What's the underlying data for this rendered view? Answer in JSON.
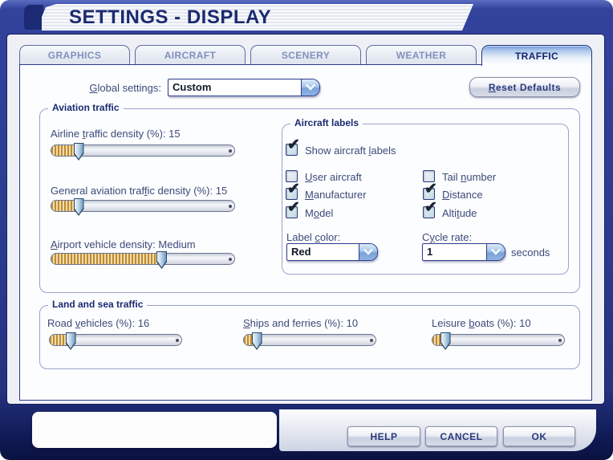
{
  "window": {
    "title": "SETTINGS - DISPLAY"
  },
  "tabs": [
    {
      "label": "GRAPHICS",
      "active": false
    },
    {
      "label": "AIRCRAFT",
      "active": false
    },
    {
      "label": "SCENERY",
      "active": false
    },
    {
      "label": "WEATHER",
      "active": false
    },
    {
      "label": "TRAFFIC",
      "active": true
    }
  ],
  "global_settings": {
    "label": {
      "text": "Global settings:",
      "accel": 0
    },
    "value": "Custom"
  },
  "reset_button": {
    "text": "Reset Defaults",
    "accel": 0
  },
  "aviation_traffic": {
    "title": "Aviation traffic",
    "sliders": [
      {
        "label": {
          "text": "Airline traffic density (%): 15",
          "accel": 8
        },
        "percent": 15
      },
      {
        "label": {
          "text": "General aviation traffic density (%): 15",
          "accel": 21
        },
        "percent": 15
      },
      {
        "label": {
          "text": "Airport vehicle density: Medium",
          "accel": 0
        },
        "percent": 60
      }
    ]
  },
  "aircraft_labels": {
    "title": "Aircraft labels",
    "show": {
      "label": {
        "text": "Show aircraft labels",
        "accel": 14
      },
      "checked": true
    },
    "options": [
      {
        "label": {
          "text": "User aircraft",
          "accel": 0
        },
        "checked": false
      },
      {
        "label": {
          "text": "Tail number",
          "accel": 5
        },
        "checked": false
      },
      {
        "label": {
          "text": "Manufacturer",
          "accel": 0
        },
        "checked": true
      },
      {
        "label": {
          "text": "Distance",
          "accel": 0
        },
        "checked": true
      },
      {
        "label": {
          "text": "Model",
          "accel": 1
        },
        "checked": true
      },
      {
        "label": {
          "text": "Altitude",
          "accel": 4
        },
        "checked": true
      }
    ],
    "label_color": {
      "label": {
        "text": "Label color:",
        "accel": 6
      },
      "value": "Red"
    },
    "cycle_rate": {
      "label": {
        "text": "Cycle rate:",
        "accel": 1
      },
      "value": "1",
      "unit": "seconds"
    }
  },
  "land_sea_traffic": {
    "title": "Land and sea traffic",
    "sliders": [
      {
        "label": {
          "text": "Road vehicles (%): 16",
          "accel": 5
        },
        "percent": 16
      },
      {
        "label": {
          "text": "Ships and ferries (%): 10",
          "accel": 0
        },
        "percent": 10
      },
      {
        "label": {
          "text": "Leisure boats (%): 10",
          "accel": 8
        },
        "percent": 10
      }
    ]
  },
  "footer": {
    "help": "HELP",
    "cancel": "CANCEL",
    "ok": "OK"
  },
  "icons": {
    "dropdown": "chevron-down-icon",
    "check": "check-icon"
  },
  "colors": {
    "frame_navy": "#2b3a8e",
    "accent_navy": "#16246b",
    "slider_fill": "#bf8a2e"
  }
}
